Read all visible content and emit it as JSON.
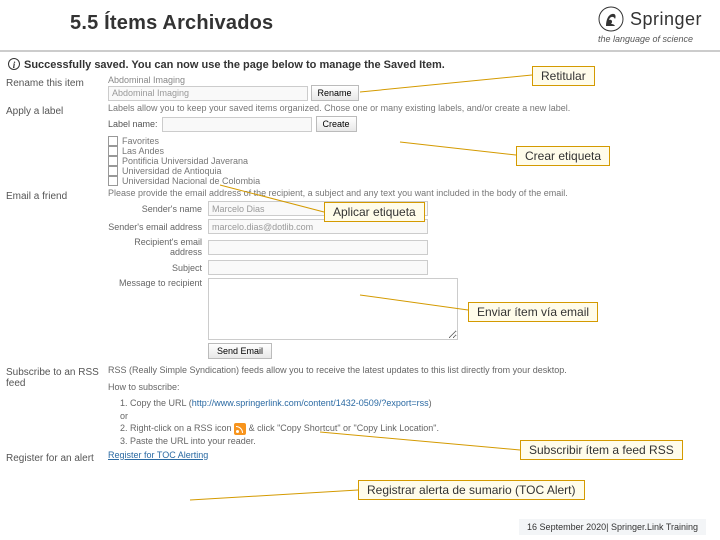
{
  "header": {
    "title": "5.5 Ítems Archivados",
    "brand": "Springer",
    "tag": "the language of science"
  },
  "banner": "Successfully saved. You can now use the page below to manage the Saved Item.",
  "labels": {
    "rename": "Rename this item",
    "apply_label": "Apply a label",
    "email": "Email a friend",
    "rss": "Subscribe to an RSS feed",
    "alert": "Register for an alert"
  },
  "rename": {
    "value": "Abdominal Imaging",
    "button": "Rename"
  },
  "apply": {
    "desc": "Labels allow you to keep your saved items organized. Chose one or many existing labels, and/or create a new label.",
    "label_name": "Label name:",
    "create": "Create",
    "checks": [
      "Favorites",
      "Las Andes",
      "Pontificia Universidad Javerana",
      "Universidad de Antioquia",
      "Universidad Nacional de Colombia"
    ]
  },
  "email": {
    "desc": "Please provide the email address of the recipient, a subject and any text you want included in the body of the email.",
    "sender_name_l": "Sender's name",
    "sender_name_v": "Marcelo Dias",
    "sender_email_l": "Sender's email address",
    "sender_email_v": "marcelo.dias@dotlib.com",
    "recip_l": "Recipient's email address",
    "subject_l": "Subject",
    "msg_l": "Message to recipient",
    "send": "Send Email"
  },
  "rss": {
    "intro": "RSS (Really Simple Syndication) feeds allow you to receive the latest updates to this list directly from your desktop.",
    "howto": "How to subscribe:",
    "step1a": "Copy the URL (",
    "step1b": "http://www.springerlink.com/content/1432-0509/?export=rss",
    "step1c": ")",
    "or": "or",
    "step2a": "Right-click on a RSS icon",
    "step2b": "& click \"Copy Shortcut\" or \"Copy Link Location\"."
  },
  "alert_link": "Register for TOC Alerting",
  "callouts": {
    "retitular": "Retitular",
    "crear": "Crear etiqueta",
    "aplicar": "Aplicar etiqueta",
    "enviar": "Enviar ítem vía email",
    "rss": "Subscribir ítem a feed RSS",
    "toc": "Registrar  alerta de sumario (TOC Alert)"
  },
  "footer": "16 September 2020| Springer.Link Training"
}
